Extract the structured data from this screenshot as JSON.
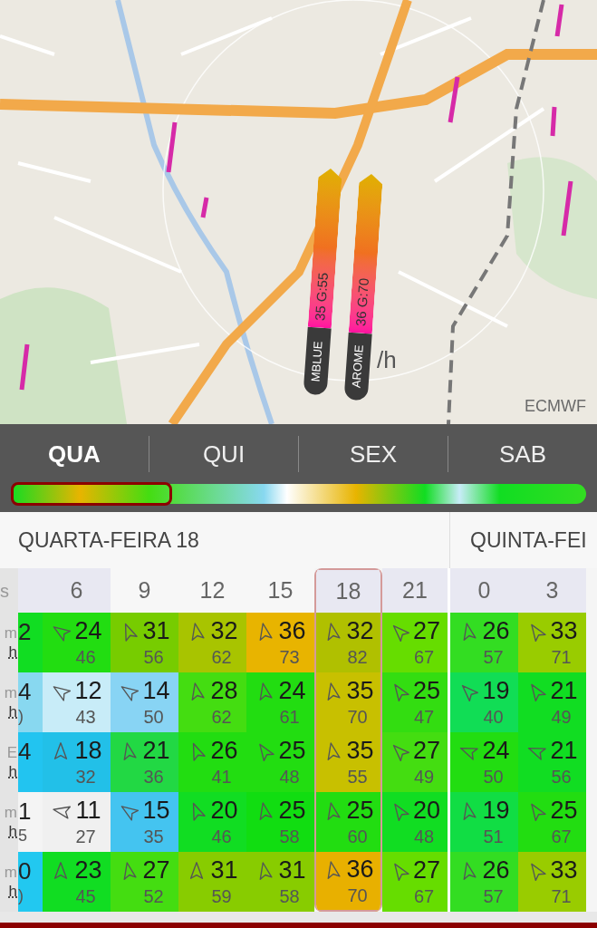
{
  "map": {
    "arrows": [
      {
        "model": "MBLUE",
        "reading": "35 G:55"
      },
      {
        "model": "AROME",
        "reading": "36 G:70"
      }
    ],
    "unit_partial": "/h",
    "source": "ECMWF"
  },
  "days": [
    {
      "label": "QUA",
      "selected": true
    },
    {
      "label": "QUI",
      "selected": false
    },
    {
      "label": "SEX",
      "selected": false
    },
    {
      "label": "SAB",
      "selected": false
    }
  ],
  "table": {
    "corner": "s",
    "days": [
      {
        "title": "QUARTA-FEIRA 18",
        "hours": [
          {
            "label": "6",
            "night": true,
            "selected": false
          },
          {
            "label": "9",
            "night": false,
            "selected": false
          },
          {
            "label": "12",
            "night": false,
            "selected": false
          },
          {
            "label": "15",
            "night": false,
            "selected": false
          },
          {
            "label": "18",
            "night": true,
            "selected": true
          },
          {
            "label": "21",
            "night": true,
            "selected": false
          }
        ]
      },
      {
        "title": "QUINTA-FEI",
        "hours": [
          {
            "label": "0",
            "night": true,
            "selected": false
          },
          {
            "label": "3",
            "night": true,
            "selected": false
          }
        ]
      }
    ],
    "rows": [
      {
        "label_top": "m",
        "label_bottom": "h",
        "partial": {
          "speed": "2",
          "color": "#11dd22"
        },
        "cells": [
          {
            "kind": "nwbw",
            "speed": "24",
            "gust": "46",
            "color": "#22dd11"
          },
          {
            "kind": "nnw",
            "speed": "31",
            "gust": "56",
            "color": "#77cc00"
          },
          {
            "kind": "nbw",
            "speed": "32",
            "gust": "62",
            "color": "#a8c400"
          },
          {
            "kind": "nbw",
            "speed": "36",
            "gust": "73",
            "color": "#e8b400"
          },
          {
            "kind": "nbw",
            "speed": "32",
            "gust": "82",
            "color": "#b0c000"
          },
          {
            "kind": "nw",
            "speed": "27",
            "gust": "67",
            "color": "#66dd00"
          },
          {
            "kind": "nbw",
            "speed": "26",
            "gust": "57",
            "color": "#33dd22"
          },
          {
            "kind": "nwbn",
            "speed": "33",
            "gust": "71",
            "color": "#99cc00"
          }
        ]
      },
      {
        "label_top": "m",
        "label_bottom": "h",
        "partial": {
          "speed": "4",
          "gust": ")",
          "color": "#88d8f0"
        },
        "cells": [
          {
            "kind": "nwbw",
            "speed": "12",
            "gust": "43",
            "color": "#c8ecf8"
          },
          {
            "kind": "nwbw",
            "speed": "14",
            "gust": "50",
            "color": "#88d4f4"
          },
          {
            "kind": "nbw",
            "speed": "28",
            "gust": "62",
            "color": "#44dd11"
          },
          {
            "kind": "nbw",
            "speed": "24",
            "gust": "61",
            "color": "#22dd11"
          },
          {
            "kind": "nbw",
            "speed": "35",
            "gust": "70",
            "color": "#c8c000"
          },
          {
            "kind": "nwbn",
            "speed": "25",
            "gust": "47",
            "color": "#33dd11"
          },
          {
            "kind": "nw",
            "speed": "19",
            "gust": "40",
            "color": "#11dd55"
          },
          {
            "kind": "nwbn",
            "speed": "21",
            "gust": "49",
            "color": "#11dd22"
          }
        ]
      },
      {
        "label_top": "E",
        "label_bottom": "h",
        "partial": {
          "speed": "4",
          "color": "#22c4f0"
        },
        "cells": [
          {
            "kind": "n",
            "speed": "18",
            "gust": "32",
            "color": "#22c0e8"
          },
          {
            "kind": "nbw",
            "speed": "21",
            "gust": "36",
            "color": "#22d844"
          },
          {
            "kind": "nnw",
            "speed": "26",
            "gust": "41",
            "color": "#22dd11"
          },
          {
            "kind": "nwbn",
            "speed": "25",
            "gust": "48",
            "color": "#22dd11"
          },
          {
            "kind": "nbw",
            "speed": "35",
            "gust": "55",
            "color": "#c8c000"
          },
          {
            "kind": "nw",
            "speed": "27",
            "gust": "49",
            "color": "#44dd11"
          },
          {
            "kind": "wnw",
            "speed": "24",
            "gust": "50",
            "color": "#22dd11"
          },
          {
            "kind": "wnw",
            "speed": "21",
            "gust": "56",
            "color": "#11dd22"
          }
        ]
      },
      {
        "label_top": "m",
        "label_bottom": "h",
        "partial": {
          "speed": "1",
          "gust": "5",
          "color": "#f4f4f4"
        },
        "cells": [
          {
            "kind": "wbn",
            "speed": "11",
            "gust": "27",
            "color": "#f0f0f0"
          },
          {
            "kind": "nwbw",
            "speed": "15",
            "gust": "35",
            "color": "#44c4f0"
          },
          {
            "kind": "nnw",
            "speed": "20",
            "gust": "46",
            "color": "#11dd22"
          },
          {
            "kind": "nbw",
            "speed": "25",
            "gust": "58",
            "color": "#11dd11"
          },
          {
            "kind": "nbw",
            "speed": "25",
            "gust": "60",
            "color": "#22dd11"
          },
          {
            "kind": "nwbn",
            "speed": "20",
            "gust": "48",
            "color": "#11dd22"
          },
          {
            "kind": "nbw",
            "speed": "19",
            "gust": "51",
            "color": "#11dd44"
          },
          {
            "kind": "nwbn",
            "speed": "25",
            "gust": "67",
            "color": "#22dd11"
          }
        ]
      },
      {
        "label_top": "m",
        "label_bottom": "h",
        "partial": {
          "speed": "0",
          "gust": ")",
          "color": "#22c8f0"
        },
        "cells": [
          {
            "kind": "n",
            "speed": "23",
            "gust": "45",
            "color": "#11dd22"
          },
          {
            "kind": "nbw",
            "speed": "27",
            "gust": "52",
            "color": "#44dd11"
          },
          {
            "kind": "n",
            "speed": "31",
            "gust": "59",
            "color": "#88cc00"
          },
          {
            "kind": "nbw",
            "speed": "31",
            "gust": "58",
            "color": "#88cc00"
          },
          {
            "kind": "nbw",
            "speed": "36",
            "gust": "70",
            "color": "#e8b000"
          },
          {
            "kind": "nwbn",
            "speed": "27",
            "gust": "67",
            "color": "#66dd00"
          },
          {
            "kind": "nbw",
            "speed": "26",
            "gust": "57",
            "color": "#33dd22"
          },
          {
            "kind": "nwbn",
            "speed": "33",
            "gust": "71",
            "color": "#99cc00"
          }
        ]
      }
    ]
  }
}
